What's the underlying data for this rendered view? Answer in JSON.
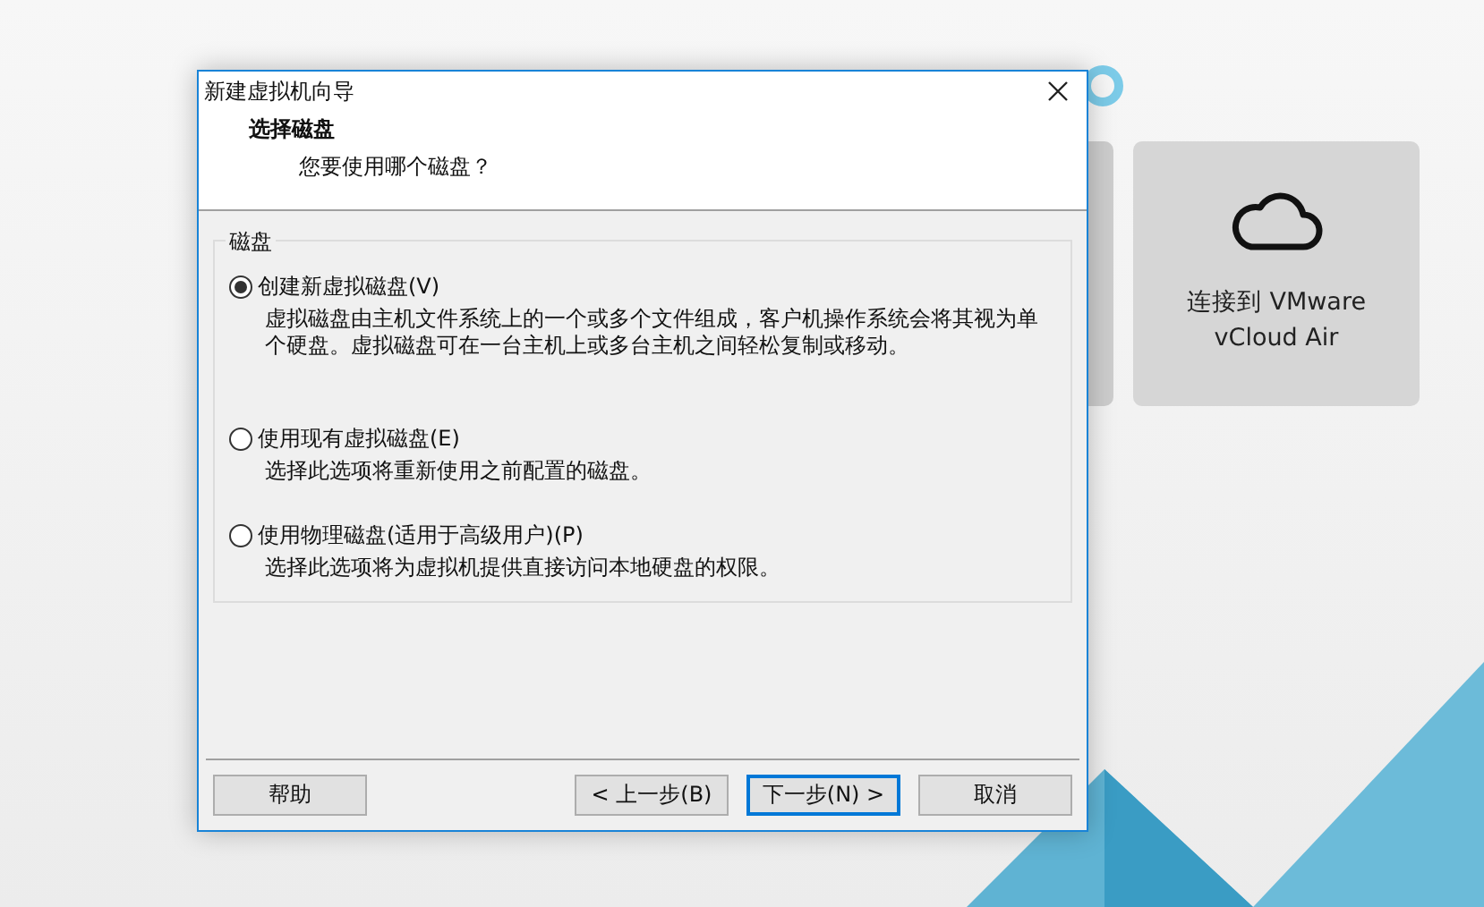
{
  "home": {
    "cards": [
      {
        "kind": "cloud",
        "lines": [
          "连接到 VMware",
          "vCloud Air"
        ]
      }
    ]
  },
  "dialog": {
    "title": "新建虚拟机向导",
    "header": {
      "title": "选择磁盘",
      "subtitle": "您要使用哪个磁盘？"
    },
    "group": {
      "label": "磁盘",
      "options": [
        {
          "label": "创建新虚拟磁盘(V)",
          "description": "虚拟磁盘由主机文件系统上的一个或多个文件组成，客户机操作系统会将其视为单个硬盘。虚拟磁盘可在一台主机上或多台主机之间轻松复制或移动。",
          "selected": true
        },
        {
          "label": "使用现有虚拟磁盘(E)",
          "description": "选择此选项将重新使用之前配置的磁盘。",
          "selected": false
        },
        {
          "label": "使用物理磁盘(适用于高级用户)(P)",
          "description": "选择此选项将为虚拟机提供直接访问本地硬盘的权限。",
          "selected": false
        }
      ]
    },
    "help_button": {
      "label": "帮助",
      "focused": false
    },
    "nav_buttons": [
      {
        "label": "< 上一步(B)",
        "focused": false
      },
      {
        "label": "下一步(N) >",
        "focused": true
      },
      {
        "label": "取消",
        "focused": false
      }
    ]
  }
}
